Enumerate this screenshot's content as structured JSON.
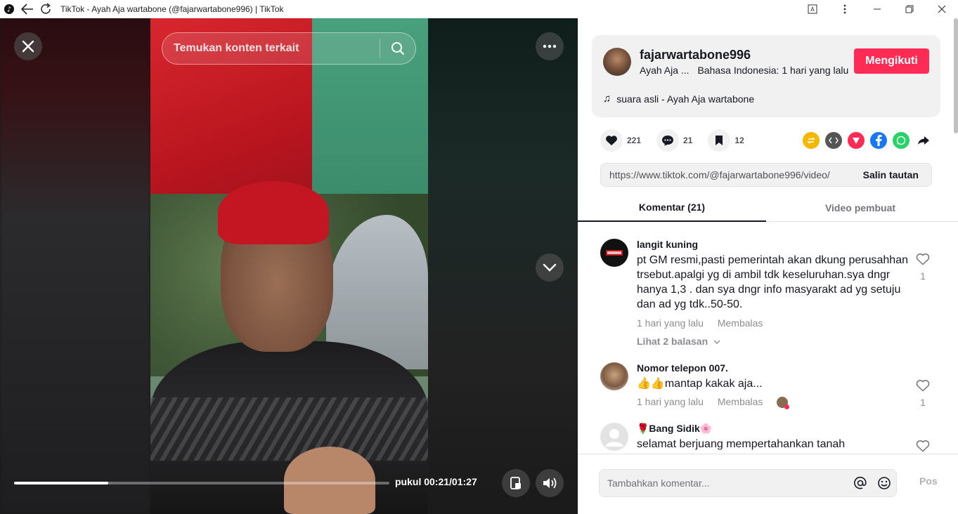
{
  "window": {
    "title": "TikTok - Ayah Aja wartabone (@fajarwartabone996) | TikTok"
  },
  "player": {
    "search_placeholder": "Temukan konten terkait",
    "time_prefix": "pukul",
    "time_display": "00:21/01:27",
    "progress_fraction": 0.25
  },
  "author": {
    "username": "fajarwartabone996",
    "display_name": "Ayah Aja ...",
    "language_time": "Bahasa Indonesia: 1 hari yang lalu",
    "follow_label": "Mengikuti",
    "music": "suara asli - Ayah Aja wartabone"
  },
  "stats": {
    "likes": "221",
    "comments": "21",
    "saves": "12"
  },
  "share_icons": [
    "repost-icon",
    "embed-icon",
    "send-icon",
    "facebook-icon",
    "whatsapp-icon",
    "share-arrow-icon"
  ],
  "link": {
    "url": "https://www.tiktok.com/@fajarwartabone996/video/",
    "copy_label": "Salin tautan"
  },
  "tabs": {
    "comments": "Komentar (21)",
    "creator_videos": "Video pembuat"
  },
  "comments": [
    {
      "user": "langit kuning",
      "text": "pt GM resmi,pasti pemerintah akan dkung perusahhan trsebut.apalgi yg di ambil tdk keseluruhan.sya dngr hanya 1,3 . dan sya dngr info masyarakt ad yg setuju dan ad yg tdk..50-50.",
      "time": "1 hari yang lalu",
      "reply": "Membalas",
      "likes": "1",
      "replies_label": "Lihat 2 balasan"
    },
    {
      "user": "Nomor telepon 007.",
      "text": "👍👍mantap kakak aja...",
      "time": "1 hari yang lalu",
      "reply": "Membalas",
      "likes": "1"
    },
    {
      "user": "🌹Bang Sidik🌸",
      "text": "selamat berjuang mempertahankan tanah"
    }
  ],
  "composer": {
    "placeholder": "Tambahkan komentar...",
    "post_label": "Pos"
  },
  "colors": {
    "accent": "#fe2c55"
  }
}
